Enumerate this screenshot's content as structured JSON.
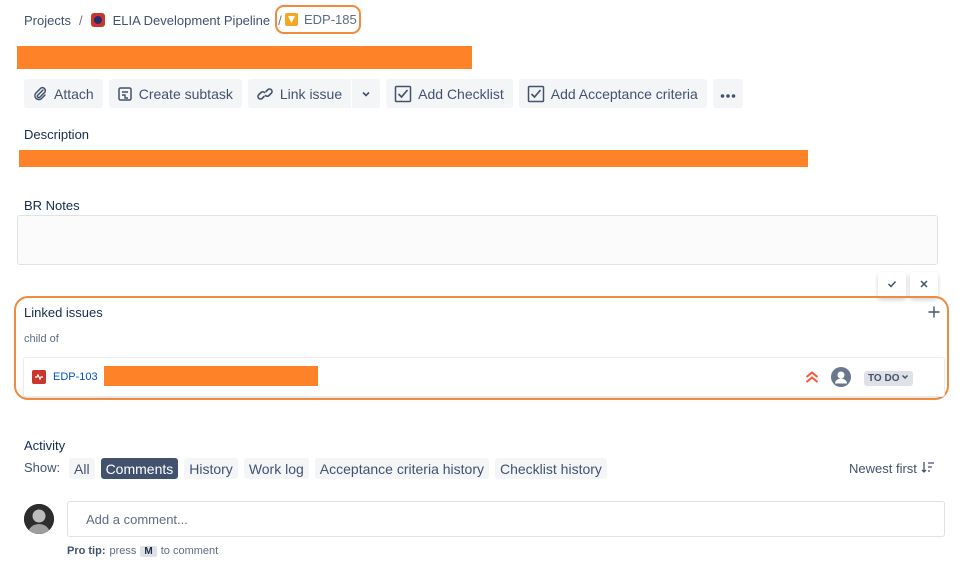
{
  "breadcrumb": {
    "projects": "Projects",
    "separator": "/",
    "project_name": "ELIA Development Pipeline",
    "issue_key": "EDP-185"
  },
  "toolbar": {
    "attach": "Attach",
    "create_subtask": "Create subtask",
    "link_issue": "Link issue",
    "add_checklist": "Add Checklist",
    "add_acceptance": "Add Acceptance criteria"
  },
  "description": {
    "label": "Description"
  },
  "br_notes": {
    "label": "BR Notes"
  },
  "linked_issues": {
    "label": "Linked issues",
    "relation": "child of",
    "items": [
      {
        "key": "EDP-103",
        "status": "TO DO",
        "priority": "highest",
        "priority_color": "#ff5630"
      }
    ]
  },
  "activity": {
    "label": "Activity",
    "show_label": "Show:",
    "filters": [
      "All",
      "Comments",
      "History",
      "Work log",
      "Acceptance criteria history",
      "Checklist history"
    ],
    "active_filter": "Comments",
    "sort": "Newest first"
  },
  "comment": {
    "placeholder": "Add a comment...",
    "tip_prefix": "Pro tip:",
    "tip_press": "press",
    "tip_key": "M",
    "tip_suffix": "to comment"
  },
  "colors": {
    "redaction": "#fd8228",
    "highlight": "#f08a3c",
    "active_filter_bg": "#42526e"
  },
  "icons": [
    "project-icon",
    "task-icon",
    "attach-icon",
    "subtask-icon",
    "link-icon",
    "chevron-down-icon",
    "checklist-icon",
    "more-icon",
    "check-icon",
    "close-icon",
    "add-icon",
    "bug-icon",
    "priority-highest-icon",
    "assignee-icon",
    "sort-icon",
    "avatar"
  ]
}
